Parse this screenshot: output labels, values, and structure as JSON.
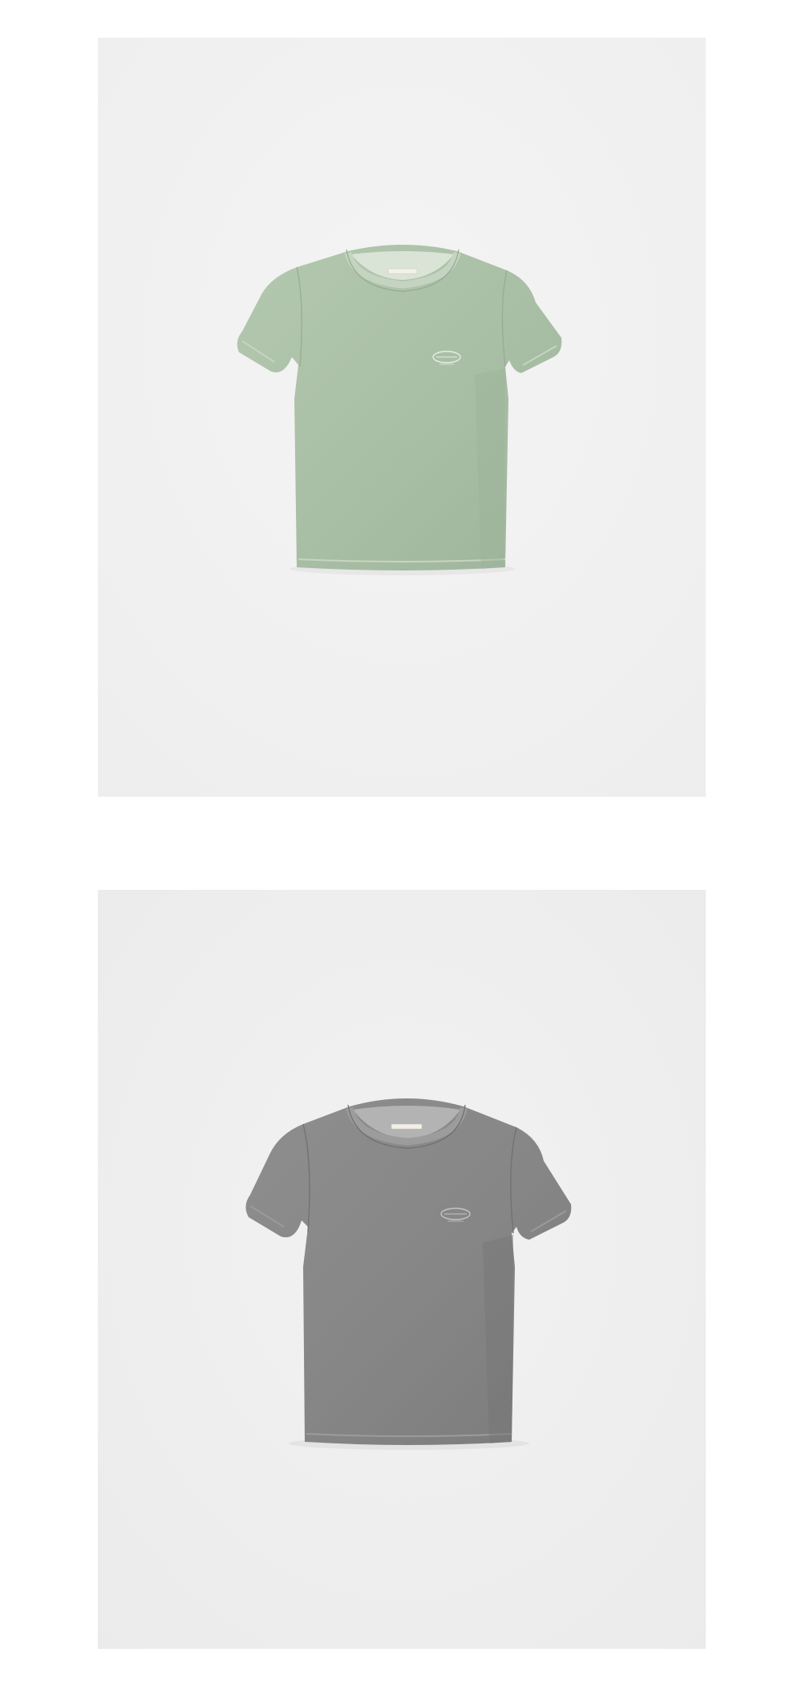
{
  "products": [
    {
      "name": "tshirt-sage",
      "garment_color": "#adc2a9",
      "panel_color": "#f2f2f2"
    },
    {
      "name": "tshirt-grey",
      "garment_color": "#888888",
      "panel_color": "#efefef"
    }
  ]
}
